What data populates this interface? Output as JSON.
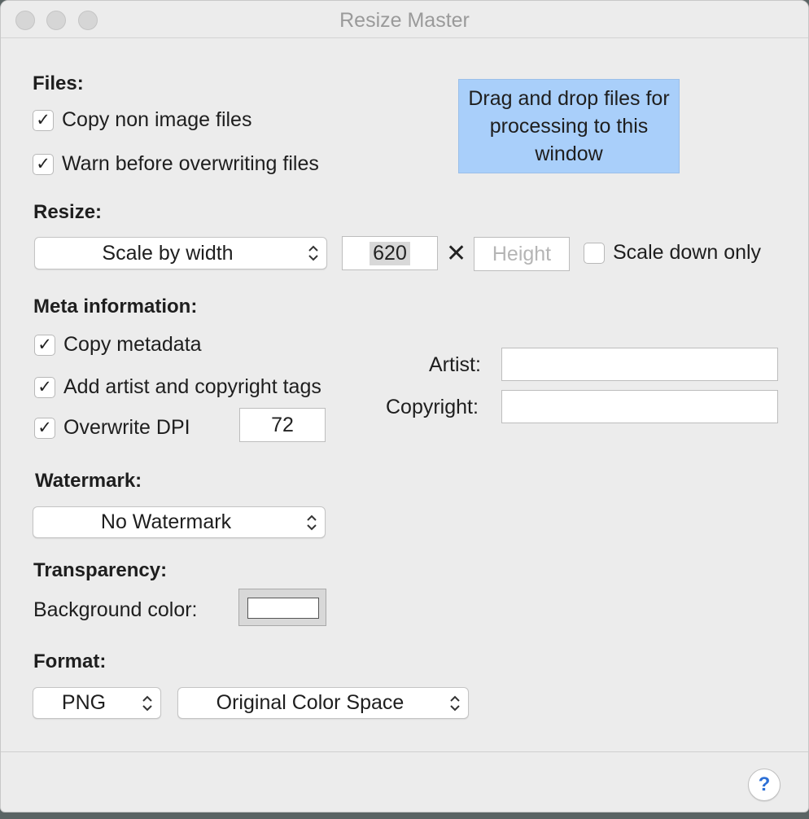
{
  "window": {
    "title": "Resize Master"
  },
  "files": {
    "heading": "Files:",
    "copy_non_image": {
      "label": "Copy non image files",
      "checked": true
    },
    "warn_overwrite": {
      "label": "Warn before overwriting files",
      "checked": true
    },
    "dropzone_text": "Drag and drop files for processing to this window"
  },
  "resize": {
    "heading": "Resize:",
    "mode": "Scale by width",
    "width_value": "620",
    "times_symbol": "✕",
    "height_placeholder": "Height",
    "scale_down_only": {
      "label": "Scale down only",
      "checked": false
    }
  },
  "meta": {
    "heading": "Meta information:",
    "copy_metadata": {
      "label": "Copy metadata",
      "checked": true
    },
    "add_tags": {
      "label": "Add artist and copyright tags",
      "checked": true
    },
    "overwrite_dpi": {
      "label": "Overwrite DPI",
      "checked": true
    },
    "dpi_value": "72",
    "artist_label": "Artist:",
    "artist_value": "",
    "copyright_label": "Copyright:",
    "copyright_value": ""
  },
  "watermark": {
    "heading": "Watermark:",
    "selected": "No Watermark"
  },
  "transparency": {
    "heading": "Transparency:",
    "bg_label": "Background color:",
    "bg_color": "#ffffff"
  },
  "format": {
    "heading": "Format:",
    "type": "PNG",
    "color_space": "Original Color Space"
  },
  "help": {
    "label": "?"
  },
  "checkmark": "✓"
}
